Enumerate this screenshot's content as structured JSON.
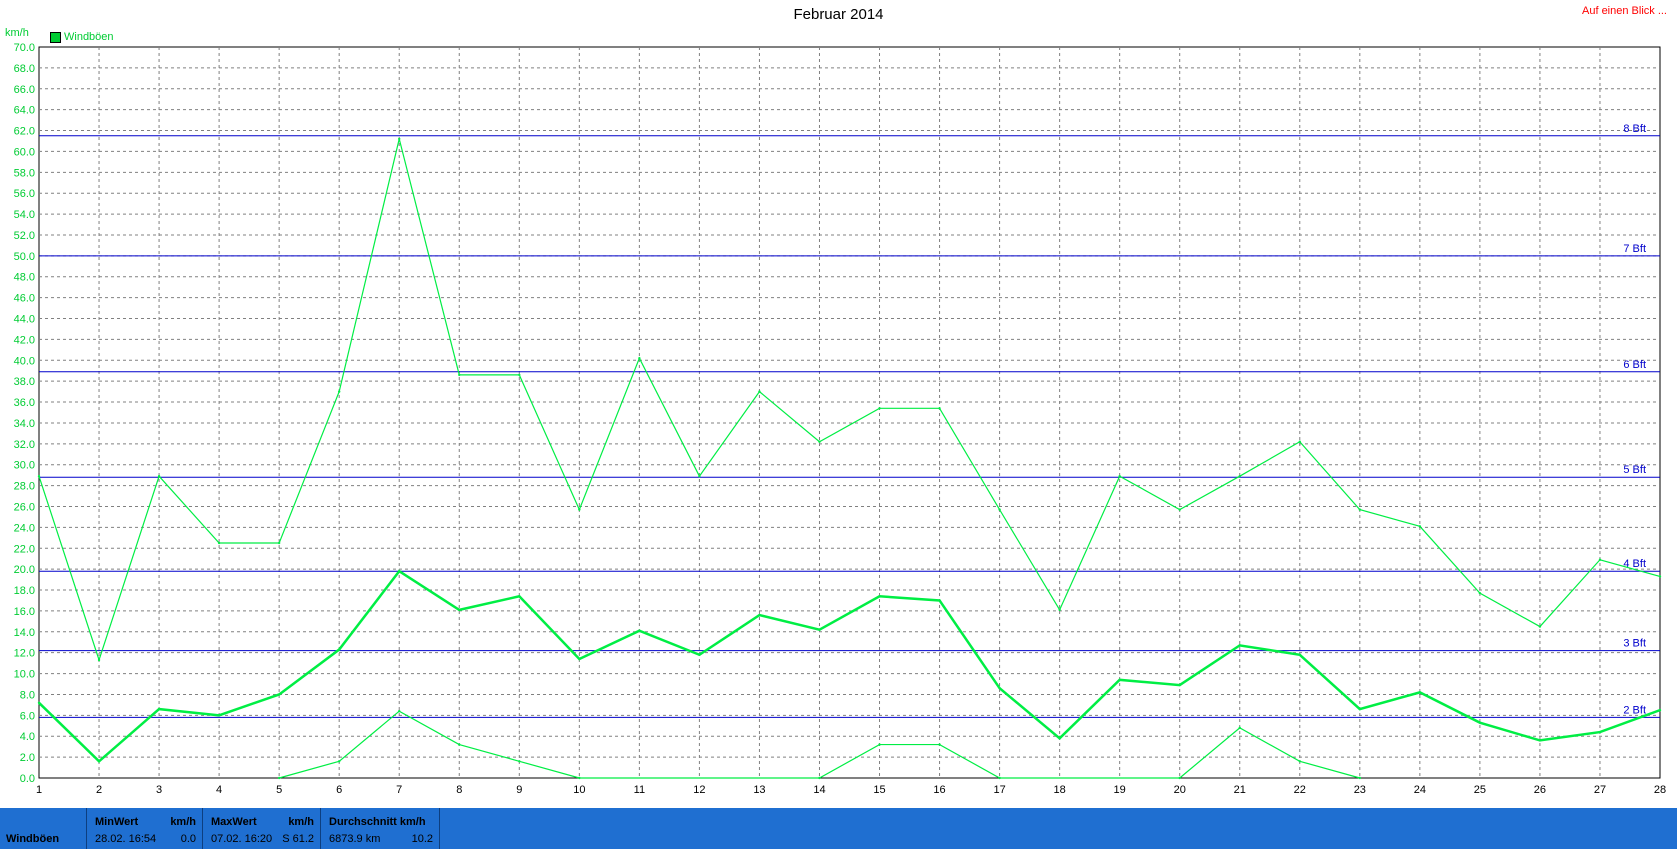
{
  "header": {
    "title": "Februar 2014",
    "link_label": "Auf einen Blick ...",
    "unit_label": "km/h",
    "legend_label": "Windböen"
  },
  "colors": {
    "series": "#00ee44",
    "grid": "#808080",
    "bft_line": "#0000cc",
    "footer_bg": "#1f6fd1",
    "link": "#ff0000"
  },
  "chart_data": {
    "type": "line",
    "title": "Februar 2014",
    "ylabel": "km/h",
    "xlabel": "",
    "x": [
      1,
      2,
      3,
      4,
      5,
      6,
      7,
      8,
      9,
      10,
      11,
      12,
      13,
      14,
      15,
      16,
      17,
      18,
      19,
      20,
      21,
      22,
      23,
      24,
      25,
      26,
      27,
      28
    ],
    "xlim": [
      1,
      28
    ],
    "ylim": [
      0,
      70
    ],
    "ytick_step": 2,
    "grid": true,
    "legend": "top-left",
    "series": [
      {
        "name": "Windböen",
        "role": "max",
        "x": [
          1,
          2,
          3,
          4,
          5,
          6,
          7,
          8,
          9,
          10,
          11,
          12,
          13,
          14,
          15,
          16,
          17,
          18,
          19,
          20,
          21,
          22,
          23,
          24,
          25,
          26,
          27,
          28
        ],
        "values": [
          28.9,
          11.3,
          28.9,
          22.5,
          22.5,
          37.0,
          61.2,
          38.6,
          38.6,
          25.7,
          40.2,
          28.9,
          37.0,
          32.2,
          35.4,
          35.4,
          25.7,
          16.1,
          28.9,
          25.7,
          28.9,
          32.2,
          25.7,
          24.1,
          17.7,
          14.5,
          20.9,
          19.3
        ]
      },
      {
        "name": "",
        "role": "avg",
        "x": [
          1,
          2,
          3,
          4,
          5,
          6,
          7,
          8,
          9,
          10,
          11,
          12,
          13,
          14,
          15,
          16,
          17,
          18,
          19,
          20,
          21,
          22,
          23,
          24,
          25,
          26,
          27,
          28
        ],
        "values": [
          7.2,
          1.6,
          6.6,
          6.0,
          8.0,
          12.3,
          19.8,
          16.1,
          17.4,
          11.4,
          14.1,
          11.8,
          15.6,
          14.2,
          17.4,
          17.0,
          8.6,
          3.8,
          9.4,
          8.9,
          12.7,
          11.8,
          6.6,
          8.2,
          5.3,
          3.6,
          4.4,
          6.5
        ]
      },
      {
        "name": "",
        "role": "min",
        "x": [
          5,
          6,
          7,
          8,
          9,
          10,
          14,
          15,
          16,
          17,
          20,
          21,
          22,
          23
        ],
        "values": [
          0.0,
          1.6,
          6.4,
          3.2,
          1.6,
          0.0,
          0.0,
          3.2,
          3.2,
          0.0,
          0.0,
          4.8,
          1.6,
          0.0
        ]
      }
    ],
    "beaufort_lines": [
      {
        "label": "2 Bft",
        "value": 5.8
      },
      {
        "label": "3 Bft",
        "value": 12.2
      },
      {
        "label": "4 Bft",
        "value": 19.8
      },
      {
        "label": "5 Bft",
        "value": 28.8
      },
      {
        "label": "6 Bft",
        "value": 38.9
      },
      {
        "label": "7 Bft",
        "value": 50.0
      },
      {
        "label": "8 Bft",
        "value": 61.5
      }
    ]
  },
  "footer": {
    "series_label": "Windböen",
    "min": {
      "head": "MinWert",
      "unit": "km/h",
      "date": "28.02.  16:54",
      "value": "0.0"
    },
    "max": {
      "head": "MaxWert",
      "unit": "km/h",
      "date": "07.02.  16:20",
      "value": "S 61.2"
    },
    "avg": {
      "head": "Durchschnitt km/h",
      "distance": "6873.9 km",
      "value": "10.2"
    }
  }
}
